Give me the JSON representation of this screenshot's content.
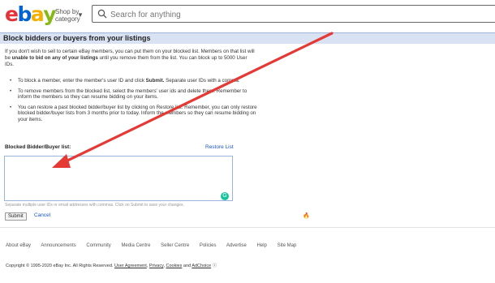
{
  "header": {
    "logo_letters": [
      "e",
      "b",
      "a",
      "y"
    ],
    "logo_colors": [
      "#e53238",
      "#0064d2",
      "#f5af02",
      "#86b817"
    ],
    "shop_by_line1": "Shop by",
    "shop_by_line2": "category",
    "search_placeholder": "Search for anything"
  },
  "page": {
    "title": "Block bidders or buyers from your listings",
    "intro_1": "If you don't wish to sell to certain eBay members, you can put them on your blocked list. Members on that list will be ",
    "intro_bold": "unable to bid on any of your listings",
    "intro_2": " until you remove them from the list. You can block up to 5000 User IDs.",
    "bullet1_a": "To block a member, enter the member's user ID and click ",
    "bullet1_bold": "Submit.",
    "bullet1_b": " Separate user IDs with a comma.",
    "bullet2": "To remove members from the blocked list, select the members' user ids and delete them. Remember to inform the members so they can resume bidding on your items.",
    "bullet3": "You can restore a past blocked bidder/buyer list by clicking on Restore list. Remember, you can only restore blocked bidder/buyer lists from 3 months prior to today. Inform the members so they can resume bidding on your items.",
    "list_label": "Blocked Bidder/Buyer list:",
    "restore_link": "Restore List",
    "hint": "Separate multiple user IDs or email addresses with commas. Click on Submit to save your changes.",
    "submit_label": "Submit",
    "cancel_label": "Cancel"
  },
  "footer": {
    "links": [
      "About eBay",
      "Announcements",
      "Community",
      "Media Centre",
      "Seller Centre",
      "Policies",
      "Advertise",
      "Help",
      "Site Map"
    ],
    "copyright_text": "Copyright © 1995-2020 eBay Inc. All Rights Reserved. ",
    "legal_links": [
      "User Agreement",
      "Privacy",
      "Cookies",
      "AdChoice"
    ],
    "sep_1": ", ",
    "sep_2": ", ",
    "sep_3": " and "
  },
  "annotation": {
    "arrow_color": "#e53935"
  }
}
